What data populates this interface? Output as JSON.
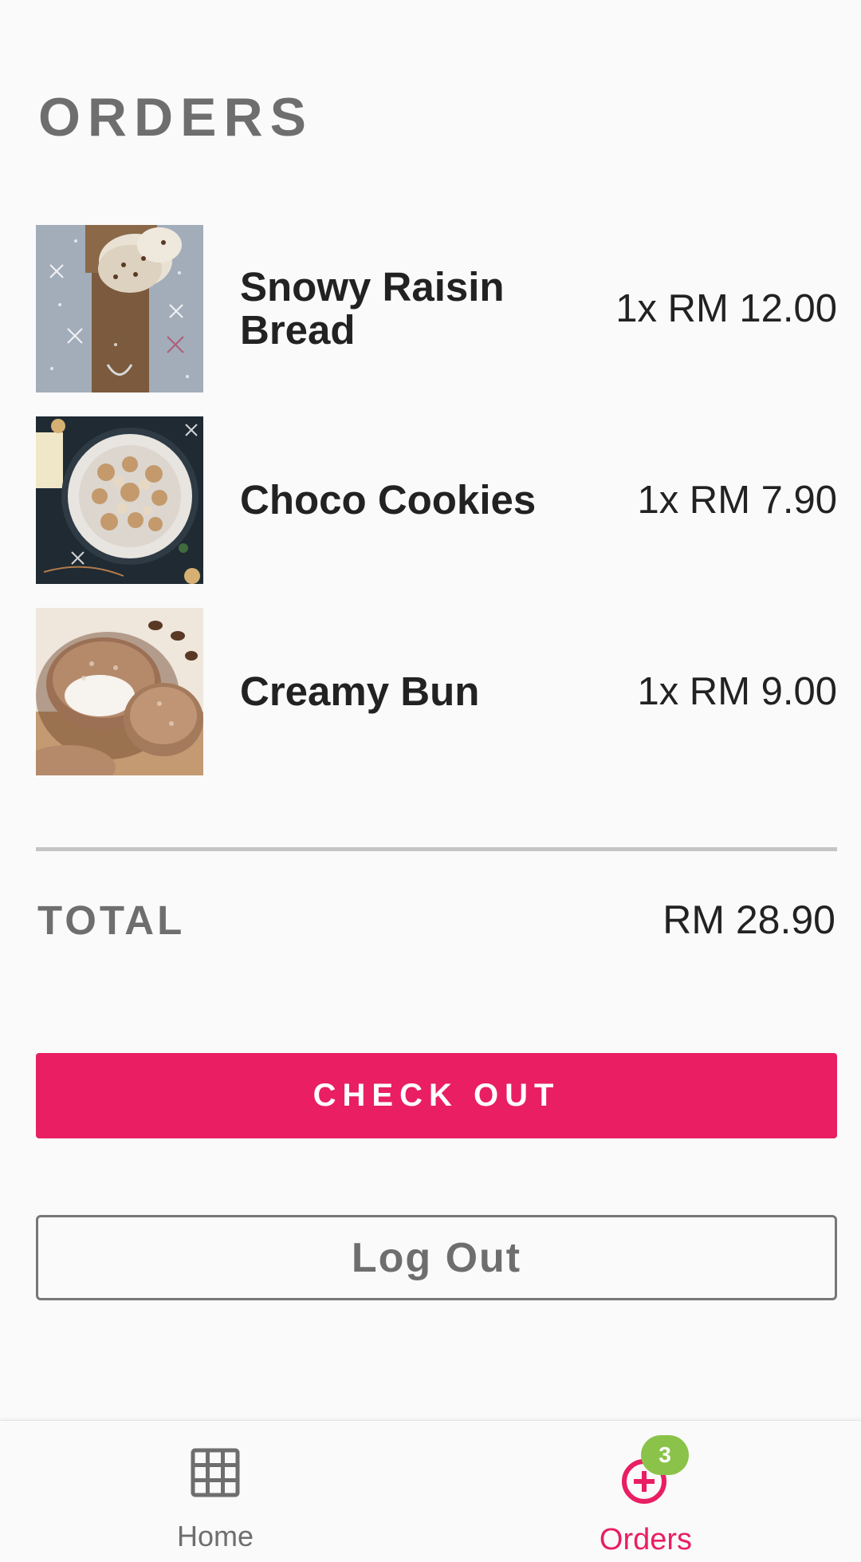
{
  "page": {
    "title": "ORDERS"
  },
  "orders": [
    {
      "name": "Snowy Raisin Bread",
      "price": "1x RM 12.00",
      "image": "raisin-bread-photo"
    },
    {
      "name": "Choco Cookies",
      "price": "1x RM 7.90",
      "image": "cookies-photo"
    },
    {
      "name": "Creamy Bun",
      "price": "1x RM 9.00",
      "image": "cream-bun-photo"
    }
  ],
  "summary": {
    "total_label": "TOTAL",
    "total_value": "RM 28.90"
  },
  "actions": {
    "checkout_label": "CHECK OUT",
    "logout_label": "Log Out"
  },
  "nav": {
    "home": {
      "label": "Home",
      "icon": "grid-icon"
    },
    "orders": {
      "label": "Orders",
      "icon": "add-circle-icon",
      "badge": "3"
    }
  },
  "colors": {
    "accent": "#e91e63",
    "badge": "#8bc34a",
    "muted_text": "#6e6e6e",
    "text": "#222222",
    "background": "#fafafa"
  }
}
